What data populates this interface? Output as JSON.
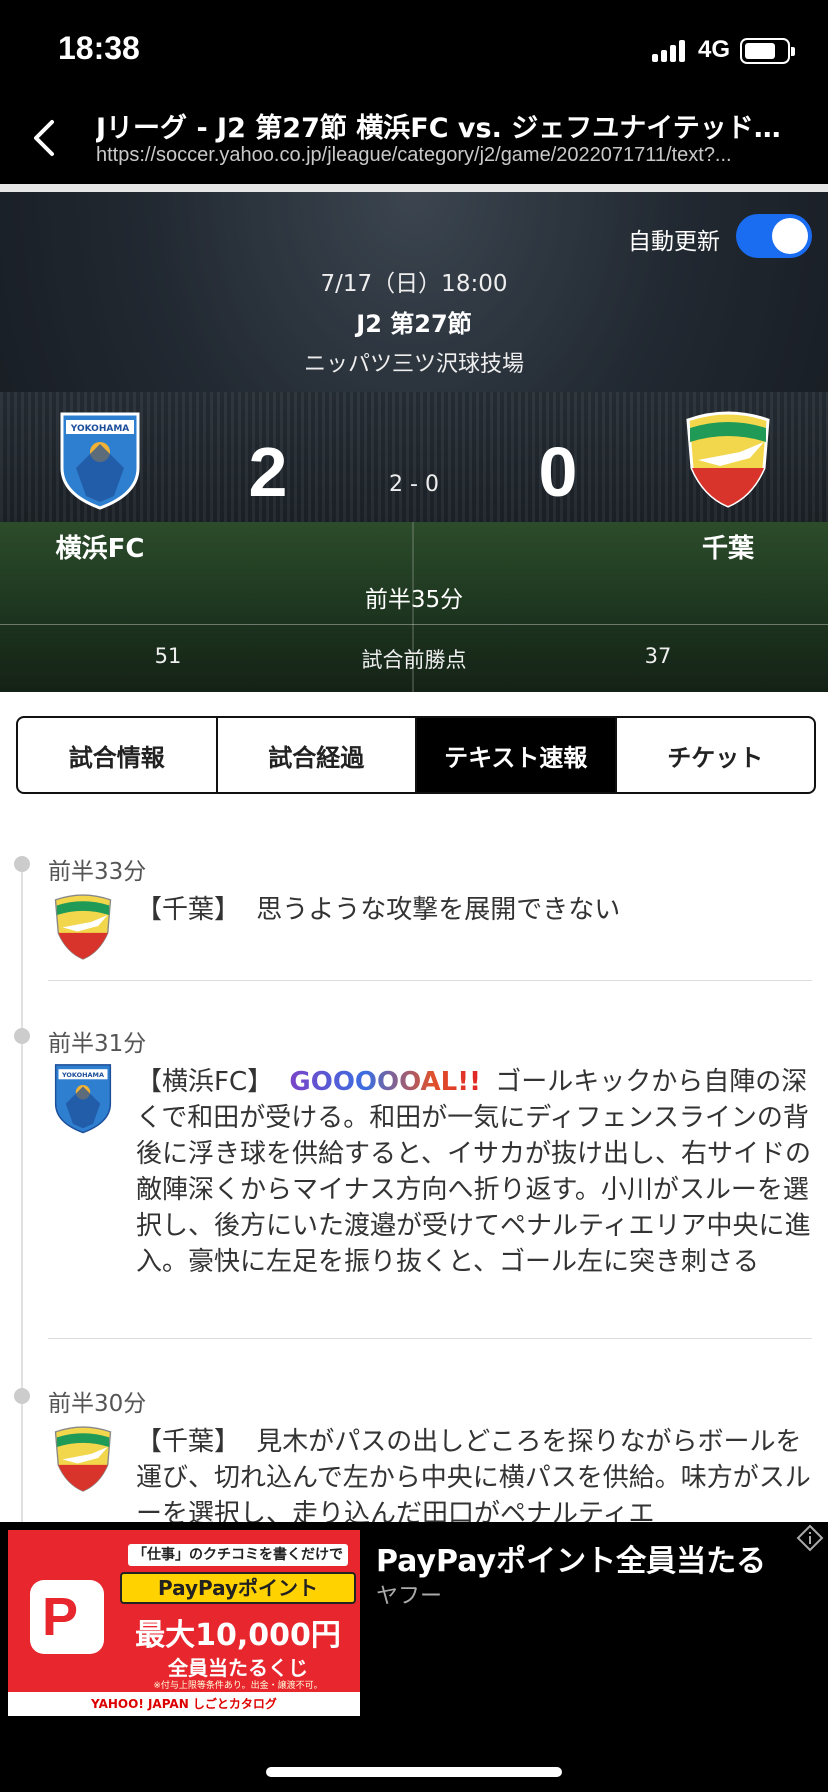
{
  "status_bar": {
    "time": "18:38",
    "network": "4G"
  },
  "browser": {
    "title": "Jリーグ - J2 第27節 横浜FC vs. ジェフユナイテッド…",
    "url": "https://soccer.yahoo.co.jp/jleague/category/j2/game/2022071711/text?..."
  },
  "match": {
    "auto_update_label": "自動更新",
    "auto_update_on": true,
    "date": "7/17（日）18:00",
    "round": "J2 第27節",
    "venue": "ニッパツ三ツ沢球技場",
    "home": {
      "name": "横浜FC",
      "score": "2",
      "points": "51",
      "crest_text": "YOKOHAMA"
    },
    "away": {
      "name": "千葉",
      "score": "0",
      "points": "37"
    },
    "half_score": "2 - 0",
    "clock": "前半35分",
    "points_label": "試合前勝点"
  },
  "tabs": [
    {
      "label": "試合情報",
      "active": false
    },
    {
      "label": "試合経過",
      "active": false
    },
    {
      "label": "テキスト速報",
      "active": true
    },
    {
      "label": "チケット",
      "active": false
    }
  ],
  "timeline": [
    {
      "time": "前半33分",
      "team": "chiba",
      "team_tag": "【千葉】",
      "highlight": "",
      "text": "思うような攻撃を展開できない"
    },
    {
      "time": "前半31分",
      "team": "yokohama",
      "team_tag": "【横浜FC】",
      "highlight": "GOOOOOAL!!",
      "text": "ゴールキックから自陣の深くで和田が受ける。和田が一気にディフェンスラインの背後に浮き球を供給すると、イサカが抜け出し、右サイドの敵陣深くからマイナス方向へ折り返す。小川がスルーを選択し、後方にいた渡邉が受けてペナルティエリア中央に進入。豪快に左足を振り抜くと、ゴール左に突き刺さる"
    },
    {
      "time": "前半30分",
      "team": "chiba",
      "team_tag": "【千葉】",
      "highlight": "",
      "text": "見木がパスの出しどころを探りながらボールを運び、切れ込んで左から中央に横パスを供給。味方がスルーを選択し、走り込んだ田口がペナルティエ"
    }
  ],
  "ad": {
    "title": "PayPayポイント全員当たる",
    "source": "ヤフー",
    "copy1": "「仕事」のクチコミを書くだけで",
    "copy2": "PayPayポイント",
    "copy3": "最大10,000円",
    "copy4": "全員当たるくじ",
    "fine": "※付与上限等条件あり。出金・譲渡不可。",
    "footer": "YAHOO! JAPAN しごとカタログ",
    "logo_letter": "P"
  },
  "colors": {
    "toggle": "#1a6cf0",
    "ad_red": "#e8262e",
    "chiba_yellow": "#f2d64b",
    "chiba_green": "#1f9a57",
    "chiba_red": "#d9342b",
    "yokohama_blue": "#2f7fd0"
  },
  "icons": [
    "back-chevron-icon",
    "signal-icon",
    "battery-icon",
    "ad-info-icon"
  ]
}
